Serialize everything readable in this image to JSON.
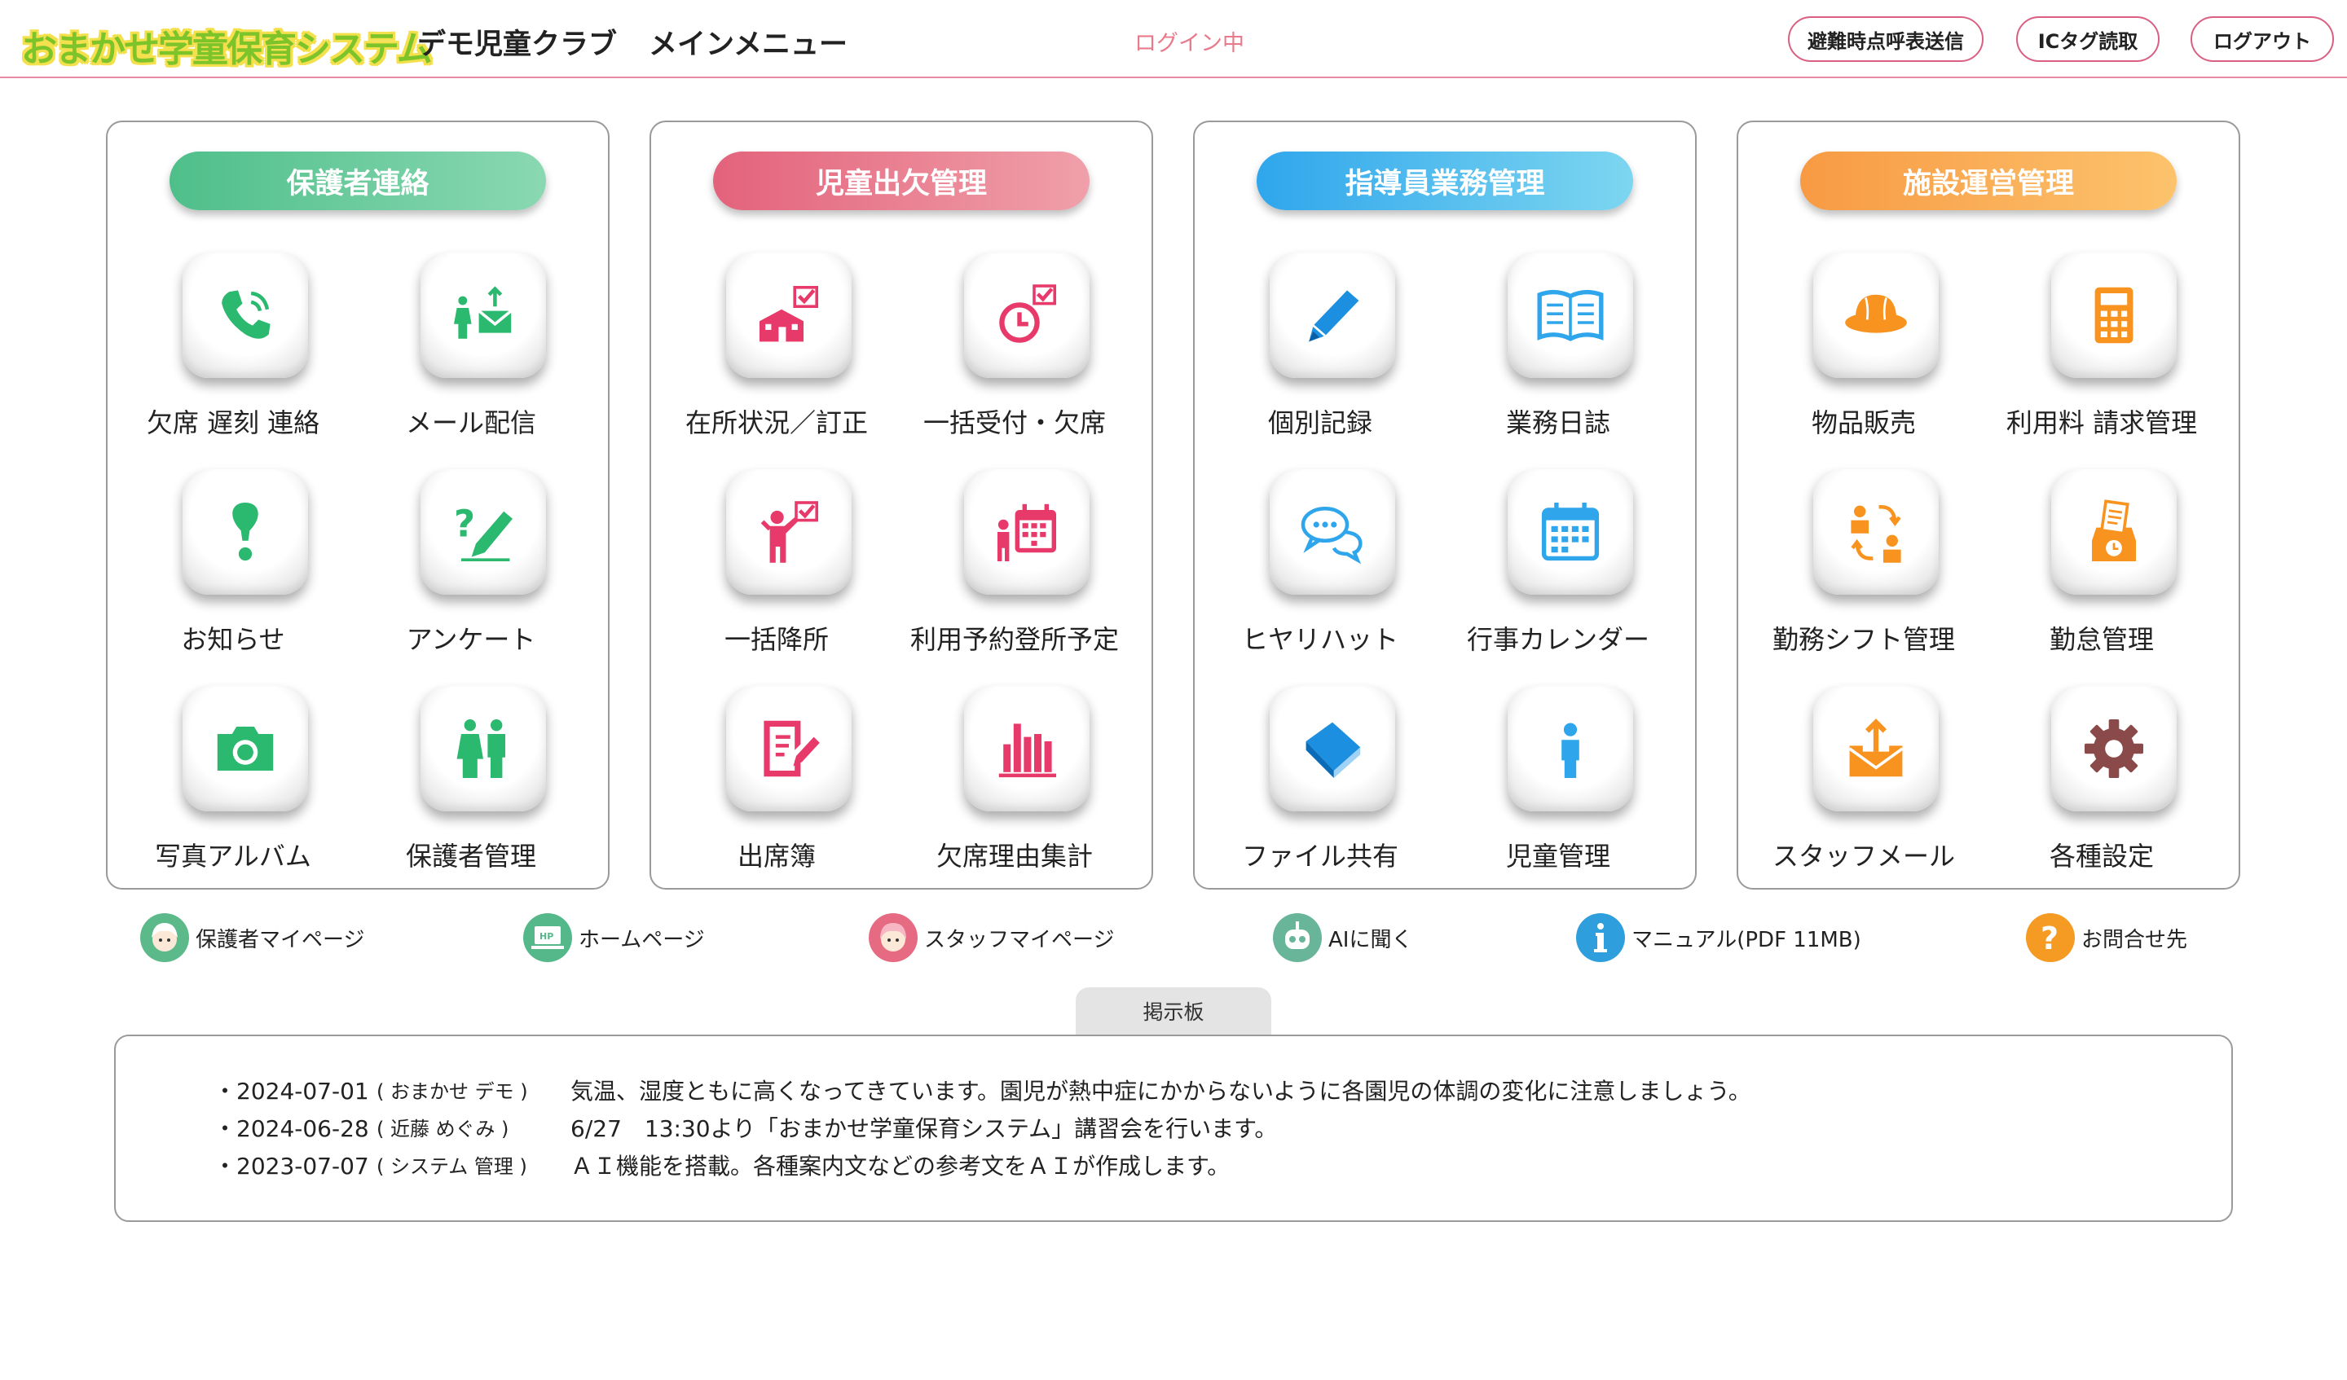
{
  "header": {
    "logo_text": "おまかせ学童保育システム",
    "club_name": "デモ児童クラブ",
    "menu_title": "メインメニュー",
    "login_status": "ログイン中",
    "buttons": [
      "避難時点呼表送信",
      "ICタグ読取",
      "ログアウト"
    ]
  },
  "panels": [
    {
      "title": "保護者連絡",
      "color": "#5cc494",
      "items": [
        {
          "label": "欠席 遅刻 連絡",
          "icon": "phone-icon"
        },
        {
          "label": "メール配信",
          "icon": "mail-parents-icon"
        },
        {
          "label": "お知らせ",
          "icon": "exclamation-icon"
        },
        {
          "label": "アンケート",
          "icon": "question-pencil-icon"
        },
        {
          "label": "写真アルバム",
          "icon": "camera-icon"
        },
        {
          "label": "保護者管理",
          "icon": "parents-icon"
        }
      ]
    },
    {
      "title": "児童出欠管理",
      "color": "#e66a82",
      "items": [
        {
          "label": "在所状況／訂正",
          "icon": "school-check-icon"
        },
        {
          "label": "一括受付・欠席",
          "icon": "clock-check-icon"
        },
        {
          "label": "一括降所",
          "icon": "child-check-icon"
        },
        {
          "label": "利用予約登所予定",
          "icon": "calendar-person-icon"
        },
        {
          "label": "出席簿",
          "icon": "document-edit-icon"
        },
        {
          "label": "欠席理由集計",
          "icon": "bar-chart-icon"
        }
      ]
    },
    {
      "title": "指導員業務管理",
      "color": "#3ab1ec",
      "items": [
        {
          "label": "個別記録",
          "icon": "pencil-icon"
        },
        {
          "label": "業務日誌",
          "icon": "open-book-icon"
        },
        {
          "label": "ヒヤリハット",
          "icon": "chat-bubbles-icon"
        },
        {
          "label": "行事カレンダー",
          "icon": "calendar-icon"
        },
        {
          "label": "ファイル共有",
          "icon": "book-icon"
        },
        {
          "label": "児童管理",
          "icon": "child-icon"
        }
      ]
    },
    {
      "title": "施設運営管理",
      "color": "#f7a04b",
      "items": [
        {
          "label": "物品販売",
          "icon": "school-hat-icon"
        },
        {
          "label": "利用料 請求管理",
          "icon": "calculator-icon"
        },
        {
          "label": "勤務シフト管理",
          "icon": "shift-swap-icon"
        },
        {
          "label": "勤怠管理",
          "icon": "time-card-icon"
        },
        {
          "label": "スタッフメール",
          "icon": "mail-upload-icon"
        },
        {
          "label": "各種設定",
          "icon": "gear-icon"
        }
      ]
    }
  ],
  "links": [
    {
      "label": "保護者マイページ",
      "icon": "parent-face-icon",
      "color": "#5cb98a"
    },
    {
      "label": "ホームページ",
      "icon": "hp-monitor-icon",
      "color": "#55b88a"
    },
    {
      "label": "スタッフマイページ",
      "icon": "staff-face-icon",
      "color": "#e66a82"
    },
    {
      "label": "AIに聞く",
      "icon": "robot-icon",
      "color": "#68b59a"
    },
    {
      "label": "マニュアル(PDF 11MB)",
      "icon": "info-icon",
      "color": "#2e9fdc"
    },
    {
      "label": "お問合せ先",
      "icon": "question-icon",
      "color": "#f59a22"
    }
  ],
  "bulletin": {
    "tab_label": "掲示板",
    "entries": [
      {
        "date": "・2024-07-01",
        "author": "( おまかせ デモ )",
        "text": "気温、湿度ともに高くなってきています。園児が熱中症にかからないように各園児の体調の変化に注意しましょう。"
      },
      {
        "date": "・2024-06-28",
        "author": "( 近藤 めぐみ )",
        "text": "6/27　13:30より「おまかせ学童保育システム」講習会を行います。"
      },
      {
        "date": "・2023-07-07",
        "author": "( システム 管理 )",
        "text": "ＡＩ機能を搭載。各種案内文などの参考文をＡＩが作成します。"
      }
    ]
  }
}
